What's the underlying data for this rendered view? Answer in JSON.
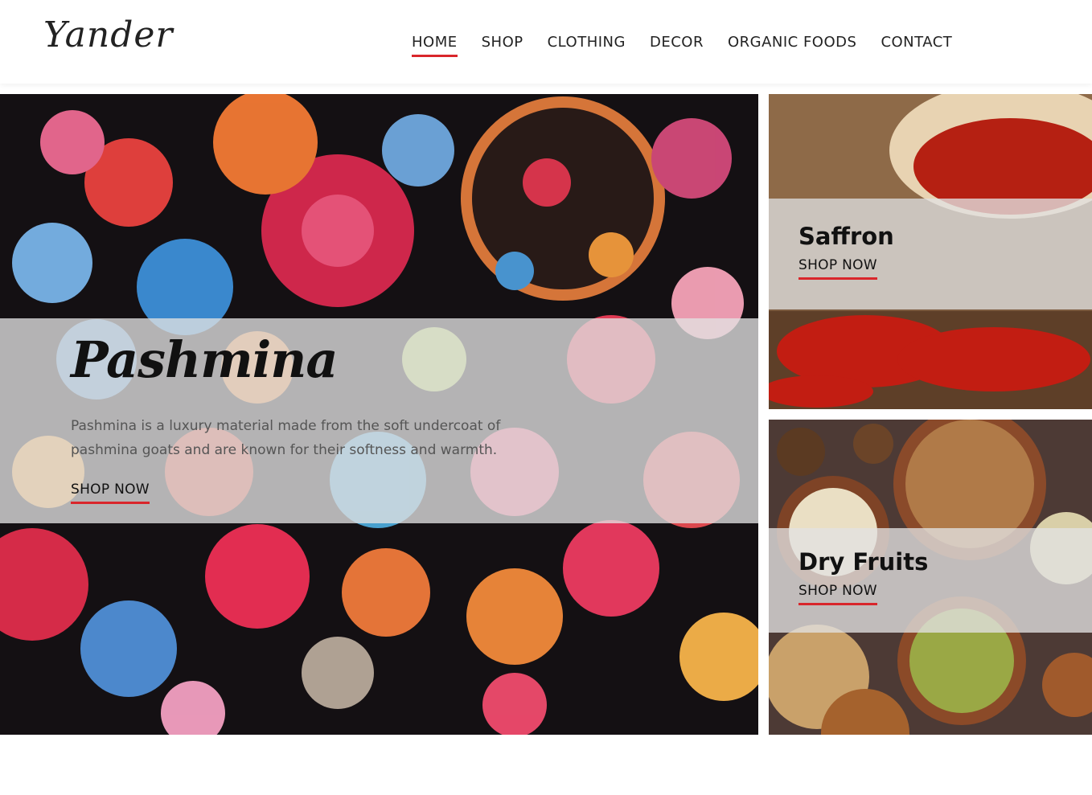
{
  "header": {
    "logo": "Yander",
    "nav": [
      {
        "label": "HOME",
        "active": true
      },
      {
        "label": "SHOP",
        "active": false
      },
      {
        "label": "CLOTHING",
        "active": false
      },
      {
        "label": "DECOR",
        "active": false
      },
      {
        "label": "ORGANIC FOODS",
        "active": false
      },
      {
        "label": "CONTACT",
        "active": false
      }
    ]
  },
  "hero": {
    "title": "Pashmina",
    "description": "Pashmina is a luxury material made from the soft undercoat of pashmina goats and are known for their softness and warmth.",
    "cta": "SHOP NOW"
  },
  "side_cards": [
    {
      "title": "Saffron",
      "cta": "SHOP NOW"
    },
    {
      "title": "Dry Fruits",
      "cta": "SHOP NOW"
    }
  ],
  "colors": {
    "accent": "#d9262b",
    "overlay": "#e1e1e1",
    "text": "#111111"
  }
}
